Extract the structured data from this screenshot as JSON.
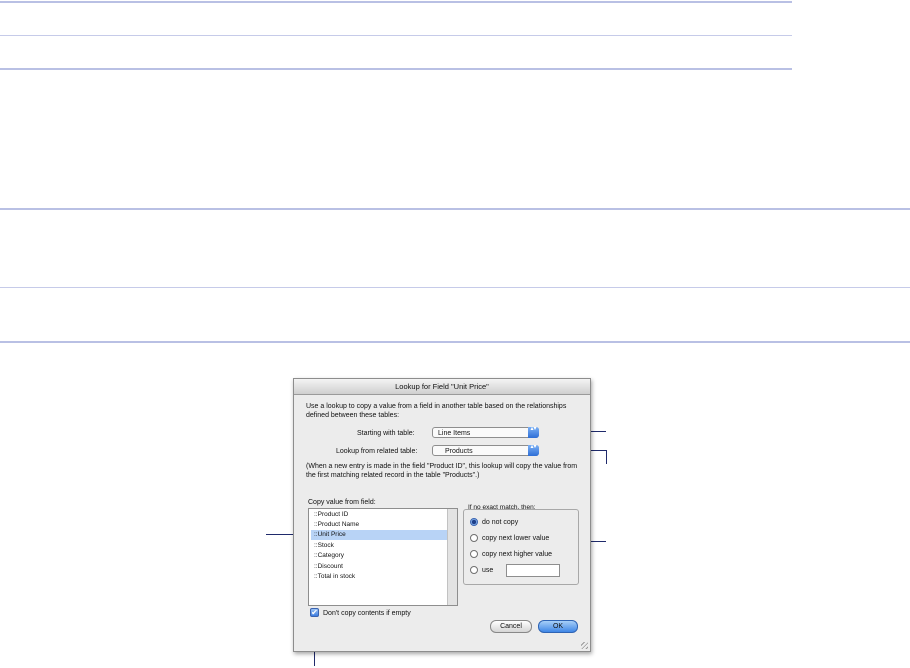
{
  "dialog": {
    "title": "Lookup for Field \"Unit Price\"",
    "intro": "Use a lookup to copy a value from a field in another table based on the relationships defined between these tables:",
    "starting_label": "Starting with table:",
    "starting_value": "Line Items",
    "related_label": "Lookup from related table:",
    "related_value": "Products",
    "explanation": "(When a new entry is made in the field \"Product ID\", this lookup will copy the value from the first matching related record in the table \"Products\".)",
    "copy_label": "Copy value from field:",
    "fields": [
      "::Product ID",
      "::Product Name",
      "::Unit Price",
      "::Stock",
      "::Category",
      "::Discount",
      "::Total in stock"
    ],
    "selected_field": "::Unit Price",
    "no_match_label": "If no exact match, then:",
    "options": {
      "do_not_copy": "do not copy",
      "next_lower": "copy next lower value",
      "next_higher": "copy next higher value",
      "use": "use"
    },
    "selected_option": "do not copy",
    "use_value": "",
    "dont_copy_label": "Don't copy contents if empty",
    "dont_copy_checked": true,
    "cancel_label": "Cancel",
    "ok_label": "OK"
  },
  "icons": {
    "check": "✔",
    "popup_arrows": "▴▾"
  }
}
